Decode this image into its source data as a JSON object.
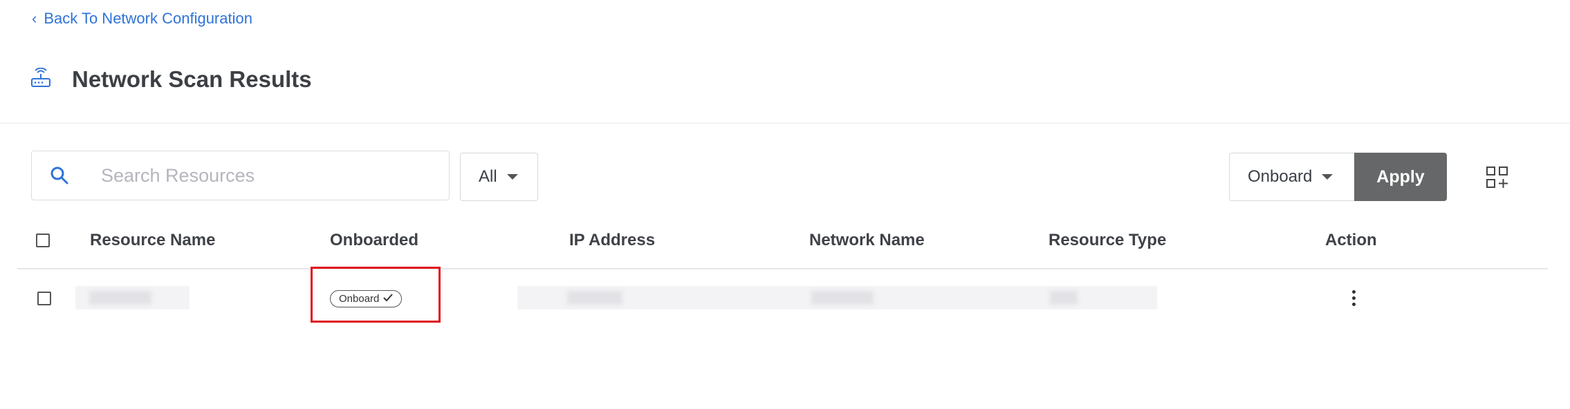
{
  "nav": {
    "back_label": "Back To Network Configuration"
  },
  "header": {
    "title": "Network Scan Results",
    "icon": "router-icon"
  },
  "toolbar": {
    "search_placeholder": "Search Resources",
    "search_value": "",
    "filter_selected": "All",
    "bulk_action_selected": "Onboard",
    "apply_label": "Apply",
    "view_icon": "grid-add-icon"
  },
  "table": {
    "columns": [
      "Resource Name",
      "Onboarded",
      "IP Address",
      "Network Name",
      "Resource Type",
      "Action"
    ],
    "rows": [
      {
        "resource_name": "",
        "onboarded": "Onboard",
        "ip_address": "",
        "network_name": "",
        "resource_type": "",
        "action_icon": "more-vertical-icon"
      }
    ]
  },
  "colors": {
    "link": "#2f73d8",
    "apply_bg": "#666768",
    "highlight": "#e0101c",
    "title": "#3c3f44"
  }
}
